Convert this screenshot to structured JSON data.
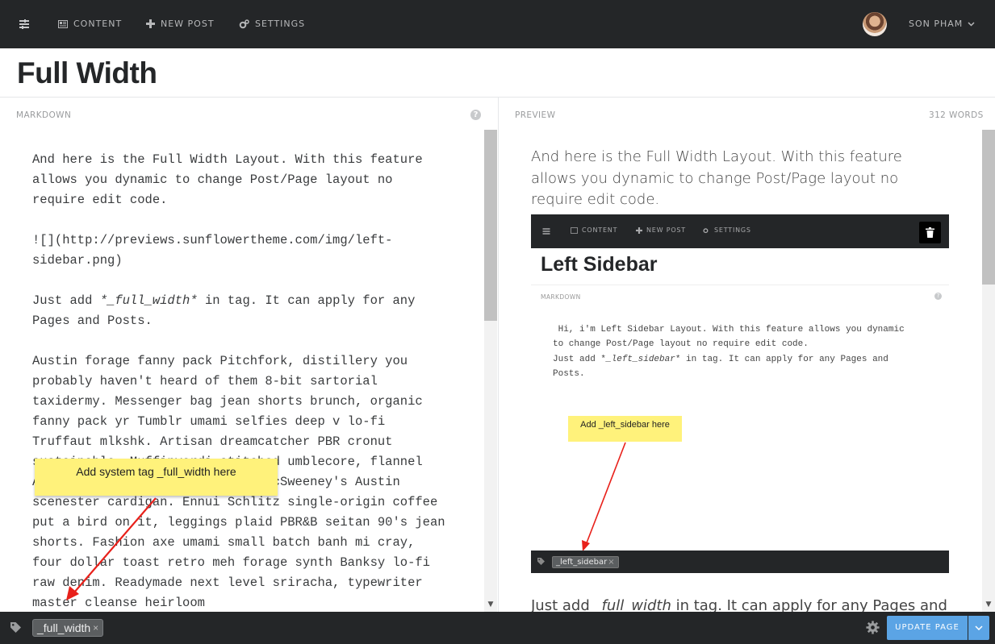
{
  "nav": {
    "content_label": "CONTENT",
    "new_post_label": "NEW POST",
    "settings_label": "SETTINGS",
    "user_name": "SON PHAM"
  },
  "page_title": "Full Width",
  "editor": {
    "markdown_label": "MARKDOWN",
    "help_symbol": "?",
    "preview_label": "PREVIEW",
    "word_count": "312 WORDS",
    "markdown_p1": "And here is the Full Width Layout. With this feature allows you dynamic to change Post/Page layout no require edit code.",
    "markdown_p2": "![](http://previews.sunflowertheme.com/img/left-sidebar.png)",
    "markdown_p3_before": "Just add ",
    "markdown_p3_em": "*_full_width*",
    "markdown_p3_after": " in tag. It can apply for any Pages and Posts.",
    "markdown_p4": "Austin forage fanny pack Pitchfork, distillery you probably haven't heard of them 8-bit sartorial taxidermy. Messenger bag jean shorts brunch, organic fanny pack yr Tumblr umami selfies deep v lo-fi Truffaut mlkshk. Artisan dreamcatcher PBR cronut sustainable. Muffinverdi stitched umblecore, flannel Austin kitchen hella vegan pug McSweeney's Austin scenester cardigan. Ennui Schlitz single-origin coffee put a bird on it, leggings plaid PBR&B seitan 90's jean shorts. Fashion axe umami small batch banh mi cray, four dollar toast retro meh forage synth Banksy lo-fi raw denim. Readymade next level sriracha, typewriter master cleanse heirloom",
    "preview_p1": "And here is the Full Width Layout. With this feature allows you dynamic to change Post/Page layout no require edit code.",
    "preview_p3_before": "Just add ",
    "preview_p3_em": "_full_width",
    "preview_p3_after": " in tag. It can apply for any Pages and Posts."
  },
  "callout": {
    "text": "Add system tag _full_width here"
  },
  "embedded_screenshot": {
    "content_label": "CONTENT",
    "new_post_label": "NEW POST",
    "settings_label": "SETTINGS",
    "title": "Left Sidebar",
    "markdown_label": "MARKDOWN",
    "help_symbol": "?",
    "text_line1": " Hi, i'm Left Sidebar Layout. With this feature allows you dynamic",
    "text_line2": "to change Post/Page layout no require edit code.",
    "text_line3_before": "Just add *",
    "text_line3_em": "_left_sidebar",
    "text_line3_after": "* in tag. It can apply for any Pages and",
    "text_line4": "Posts.",
    "note_text": "Add _left_sidebar here",
    "tag_label": "_left_sidebar",
    "tag_remove": "×"
  },
  "footer": {
    "tag_label": "_full_width",
    "tag_remove": "×",
    "update_label": "UPDATE PAGE"
  },
  "colors": {
    "accent": "#5ba4e5",
    "dark": "#242628",
    "note": "#fff27b",
    "arrow": "#e8201a"
  }
}
